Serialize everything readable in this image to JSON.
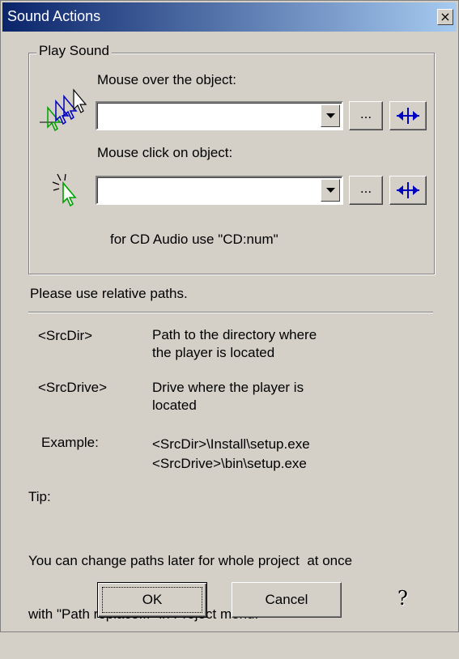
{
  "window": {
    "title": "Sound Actions",
    "close_glyph": "×"
  },
  "play_sound": {
    "group_label": "Play Sound",
    "mouse_over_label": "Mouse over the object:",
    "mouse_over_value": "",
    "mouse_click_label": "Mouse click on object:",
    "mouse_click_value": "",
    "browse_label": "...",
    "cd_hint": "for CD Audio use \"CD:num\""
  },
  "info": {
    "relative_paths": "Please use relative paths.",
    "srcdir_key": "<SrcDir>",
    "srcdir_desc_1": "Path to the directory where",
    "srcdir_desc_2": "the player is located",
    "srcdrive_key": "<SrcDrive>",
    "srcdrive_desc_1": "Drive where the player is",
    "srcdrive_desc_2": "located",
    "example_key": "Example:",
    "example_1": "<SrcDir>\\Install\\setup.exe",
    "example_2": "<SrcDrive>\\bin\\setup.exe",
    "tip_label": "Tip:",
    "tip_1": "You can change paths later for whole project  at once",
    "tip_2": "with \"Path replace...\" in Project menu."
  },
  "buttons": {
    "ok": "OK",
    "cancel": "Cancel",
    "help_glyph": "?"
  },
  "icons": {
    "mouse_over": "mouse-over-cursor-icon",
    "mouse_click": "mouse-click-cursor-icon",
    "play": "play-sound-icon",
    "dropdown": "chevron-down-icon"
  },
  "colors": {
    "title_start": "#0a246a",
    "title_end": "#a6caf0",
    "face": "#d4d0c8",
    "icon_blue": "#0000c0"
  }
}
